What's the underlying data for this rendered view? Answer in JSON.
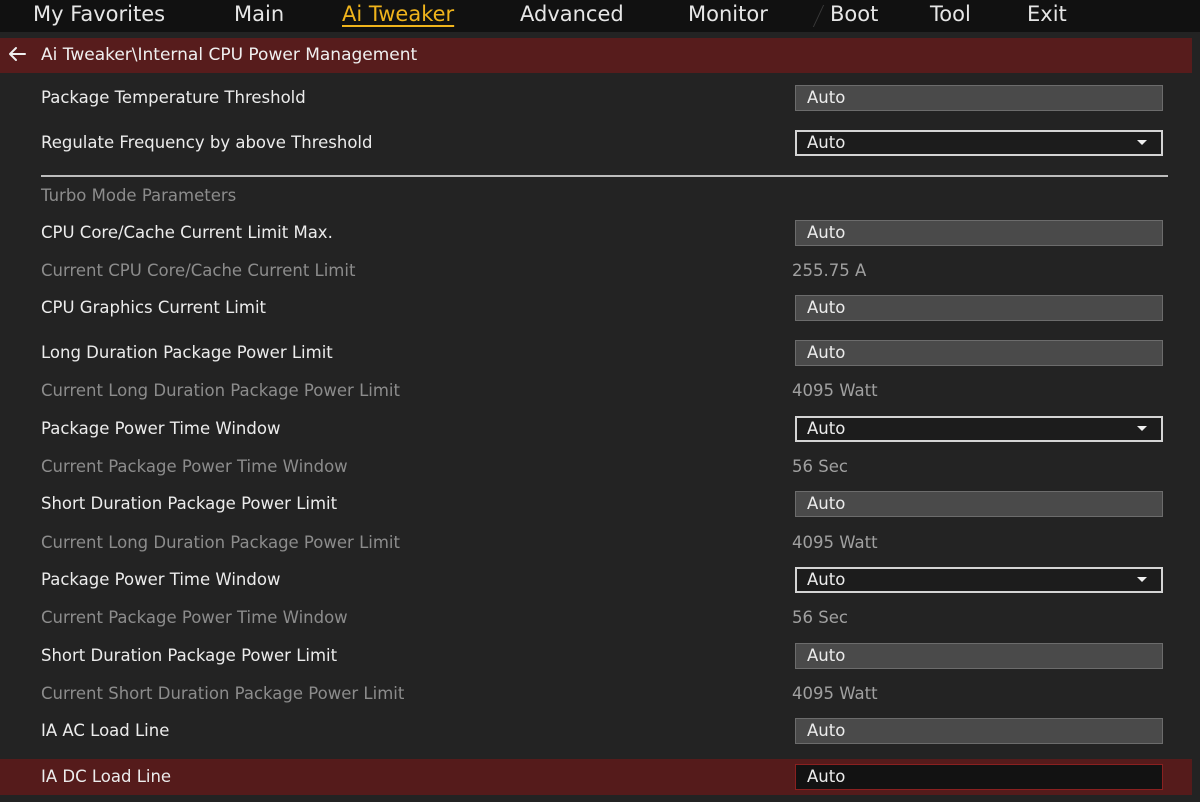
{
  "menu": {
    "tabs": [
      "My Favorites",
      "Main",
      "Ai Tweaker",
      "Advanced",
      "Monitor",
      "Boot",
      "Tool",
      "Exit"
    ],
    "active_tab": "Ai Tweaker"
  },
  "breadcrumb": {
    "path": "Ai Tweaker\\Internal CPU Power Management"
  },
  "section": {
    "turbo_heading": "Turbo Mode Parameters"
  },
  "settings": [
    {
      "label": "Package Temperature Threshold",
      "kind": "input",
      "value": "Auto"
    },
    {
      "label": "Regulate Frequency by above Threshold",
      "kind": "dropdown",
      "value": "Auto"
    },
    {
      "label": "CPU Core/Cache Current Limit Max.",
      "kind": "input",
      "value": "Auto"
    },
    {
      "label": "Current CPU Core/Cache Current Limit",
      "kind": "readout",
      "value": "255.75 A"
    },
    {
      "label": "CPU Graphics Current Limit",
      "kind": "input",
      "value": "Auto"
    },
    {
      "label": "Long Duration Package Power Limit",
      "kind": "input",
      "value": "Auto"
    },
    {
      "label": "Current Long Duration Package Power Limit",
      "kind": "readout",
      "value": "4095 Watt"
    },
    {
      "label": "Package Power Time Window",
      "kind": "dropdown",
      "value": "Auto"
    },
    {
      "label": "Current Package Power Time Window",
      "kind": "readout",
      "value": "56 Sec"
    },
    {
      "label": "Short Duration Package Power Limit",
      "kind": "input",
      "value": "Auto"
    },
    {
      "label": "Current Long Duration Package Power Limit",
      "kind": "readout",
      "value": "4095 Watt"
    },
    {
      "label": "Package Power Time Window",
      "kind": "dropdown",
      "value": "Auto"
    },
    {
      "label": "Current Package Power Time Window",
      "kind": "readout",
      "value": "56 Sec"
    },
    {
      "label": "Short Duration Package Power Limit",
      "kind": "input",
      "value": "Auto"
    },
    {
      "label": "Current Short Duration Package Power Limit",
      "kind": "readout",
      "value": "4095 Watt"
    },
    {
      "label": "IA AC Load Line",
      "kind": "input",
      "value": "Auto"
    },
    {
      "label": "IA DC Load Line",
      "kind": "input",
      "value": "Auto",
      "selected": true
    }
  ],
  "colors": {
    "accent": "#f0b41c",
    "highlight": "#571c1c",
    "background": "#232323"
  },
  "icons": {
    "back": "back-arrow-icon",
    "dropdown": "chevron-down-icon"
  }
}
